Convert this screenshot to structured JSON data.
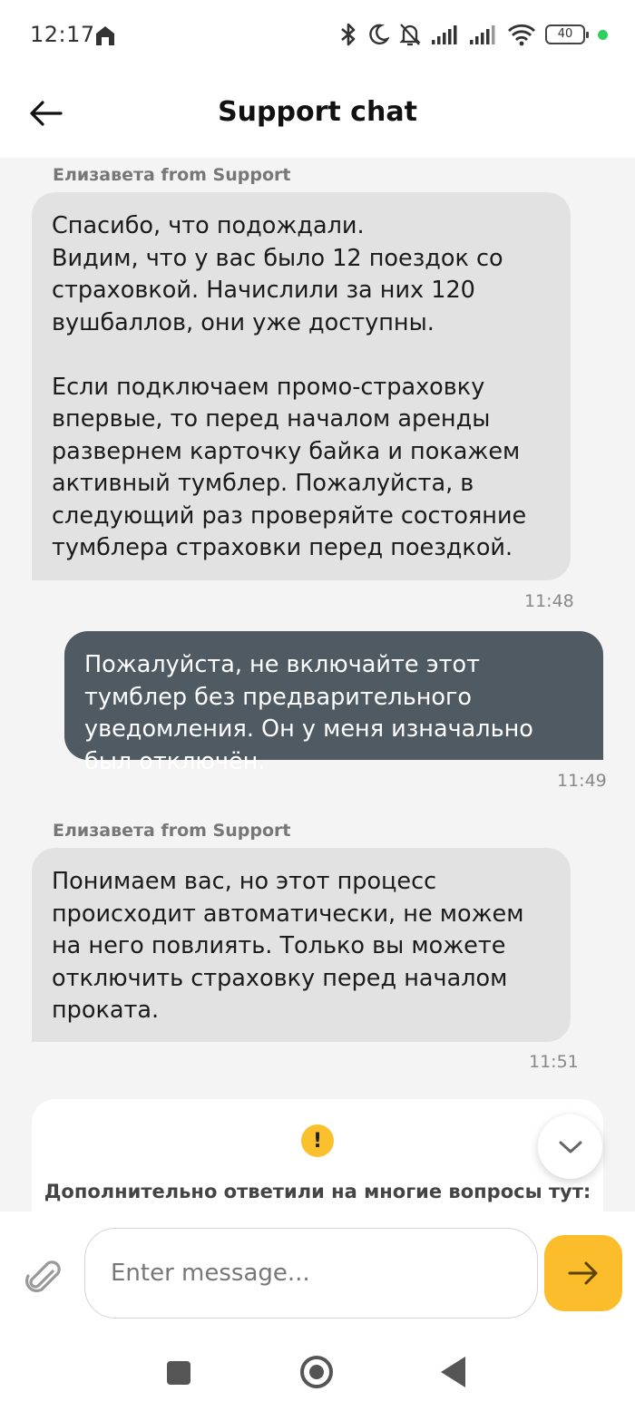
{
  "status_bar": {
    "time": "12:17",
    "battery": "40",
    "icons": [
      "home-icon",
      "bluetooth-icon",
      "moon-icon",
      "bell-off-icon",
      "signal-icon",
      "signal-icon",
      "wifi-icon",
      "battery-icon"
    ]
  },
  "header": {
    "title": "Support chat",
    "back_icon": "arrow-left-icon"
  },
  "messages": [
    {
      "direction": "incoming",
      "sender": "Елизавета from Support",
      "text": "Спасибо, что подождали.\nВидим, что у вас было 12 поездок со страховкой. Начислили за них 120 вушбаллов, они уже доступны.\n\nЕсли подключаем промо-страховку впервые, то перед началом аренды развернем карточку байка и покажем активный тумблер. Пожалуйста, в следующий раз проверяйте состояние тумблера страховки перед поездкой.",
      "time": "11:48"
    },
    {
      "direction": "outgoing",
      "text": "Пожалуйста, не включайте этот тумблер без предварительного уведомления. Он у меня изначально был отключён.",
      "time": "11:49"
    },
    {
      "direction": "incoming",
      "sender": "Елизавета from Support",
      "text": "Понимаем вас, но этот процесс происходит автоматически, не можем на него повлиять. Только вы можете отключить страховку перед началом проката.",
      "time": "11:51"
    }
  ],
  "info_card": {
    "icon": "exclamation-icon",
    "text": "Дополнительно ответили на многие вопросы тут:"
  },
  "composer": {
    "placeholder": "Enter message...",
    "attach_icon": "paperclip-icon",
    "send_icon": "arrow-right-icon"
  },
  "colors": {
    "accent": "#fbbd2c",
    "outgoing_bubble": "#4f5a63",
    "incoming_bubble": "#e2e2e2",
    "background": "#f4f4f4"
  }
}
